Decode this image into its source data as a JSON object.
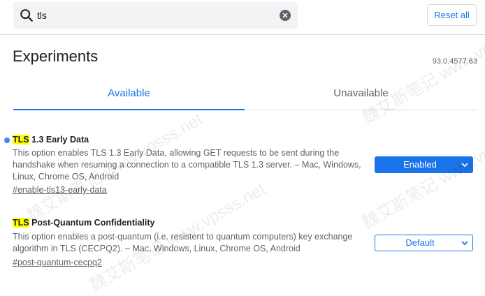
{
  "search": {
    "value": "tls",
    "placeholder": ""
  },
  "reset_label": "Reset all",
  "title": "Experiments",
  "version": "93.0.4577.63",
  "tabs": {
    "available": "Available",
    "unavailable": "Unavailable"
  },
  "experiments": [
    {
      "highlight": "TLS",
      "title_rest": " 1.3 Early Data",
      "description": "This option enables TLS 1.3 Early Data, allowing GET requests to be sent during the handshake when resuming a connection to a compatible TLS 1.3 server. – Mac, Windows, Linux, Chrome OS, Android",
      "link": "#enable-tls13-early-data",
      "state": "Enabled"
    },
    {
      "highlight": "TLS",
      "title_rest": " Post-Quantum Confidentiality",
      "description": "This option enables a post-quantum (i.e. resistent to quantum computers) key exchange algorithm in TLS (CECPQ2). – Mac, Windows, Linux, Chrome OS, Android",
      "link": "#post-quantum-cecpq2",
      "state": "Default"
    }
  ],
  "watermark": "魏艾斯笔记 www.vpsss.net",
  "colors": {
    "accent": "#1a73e8",
    "dot": "#4285f4",
    "highlight": "#ffff00"
  },
  "icons": [
    "search-icon",
    "clear-icon",
    "chevron-down-icon"
  ]
}
